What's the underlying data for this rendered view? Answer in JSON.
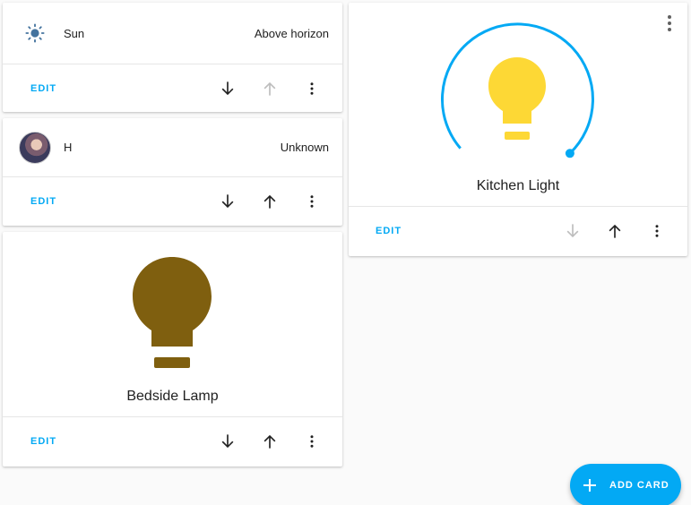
{
  "cards": {
    "sun": {
      "entity_name": "Sun",
      "state": "Above horizon",
      "icon": "sun-icon",
      "edit_label": "EDIT"
    },
    "person": {
      "entity_name": "H",
      "state": "Unknown",
      "icon": "avatar",
      "edit_label": "EDIT"
    },
    "bedside": {
      "name": "Bedside Lamp",
      "icon": "lightbulb-icon",
      "bulb_color": "#7f5f0f",
      "edit_label": "EDIT"
    },
    "kitchen": {
      "name": "Kitchen Light",
      "icon": "lightbulb-icon",
      "bulb_color": "#fdd835",
      "slider_color": "#03a9f4",
      "edit_label": "EDIT"
    }
  },
  "fab": {
    "label": "ADD CARD",
    "icon": "plus-icon"
  },
  "colors": {
    "accent": "#03a9f4",
    "disabled": "#bdbdbd",
    "sun_icon": "#44739e"
  }
}
